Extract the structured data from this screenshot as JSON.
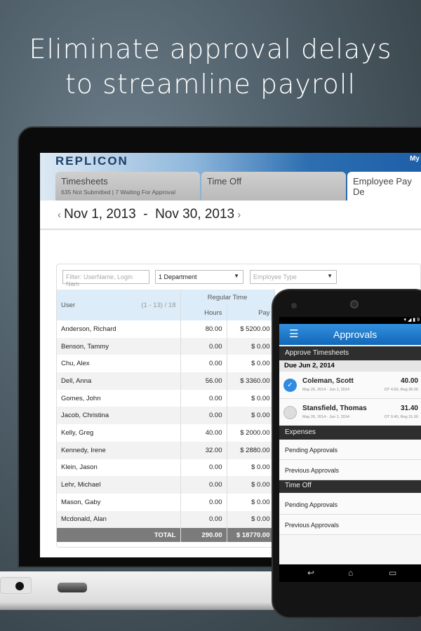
{
  "headline": [
    "Eliminate approval delays",
    "to streamline payroll"
  ],
  "web": {
    "logo": "REPLICON",
    "my": "My",
    "tabs": [
      {
        "label": "Timesheets",
        "sub1": "635 Not Submitted",
        "sub2": "7 Waiting For Approval"
      },
      {
        "label": "Time Off"
      },
      {
        "label": "Employee Pay De"
      }
    ],
    "date_range": "Nov 1, 2013  -  Nov 30, 2013",
    "filter_placeholder": "Filter: UserName, Login Nam",
    "department": "1 Department",
    "employee_type": "Employee Type",
    "headers": {
      "user": "User",
      "range": "(1 - 13) / 18",
      "regular": "Regular Time",
      "hours": "Hours",
      "pay": "Pay"
    },
    "rows": [
      [
        "Anderson, Richard",
        "80.00",
        "$ 5200.00"
      ],
      [
        "Benson, Tammy",
        "0.00",
        "$ 0.00"
      ],
      [
        "Chu, Alex",
        "0.00",
        "$ 0.00"
      ],
      [
        "Dell, Anna",
        "56.00",
        "$ 3360.00"
      ],
      [
        "Gomes, John",
        "0.00",
        "$ 0.00"
      ],
      [
        "Jacob, Christina",
        "0.00",
        "$ 0.00"
      ],
      [
        "Kelly, Greg",
        "40.00",
        "$ 2000.00"
      ],
      [
        "Kennedy, Irene",
        "32.00",
        "$ 2880.00"
      ],
      [
        "Klein, Jason",
        "0.00",
        "$ 0.00"
      ],
      [
        "Lehr, Michael",
        "0.00",
        "$ 0.00"
      ],
      [
        "Mason, Gaby",
        "0.00",
        "$ 0.00"
      ],
      [
        "Mcdonald, Alan",
        "0.00",
        "$ 0.00"
      ]
    ],
    "total": {
      "label": "TOTAL",
      "hours": "290.00",
      "pay": "$ 18770.00"
    }
  },
  "mobile": {
    "status": "9",
    "title": "Approvals",
    "approve_timesheets": "Approve Timesheets",
    "due": "Due Jun 2, 2014",
    "items": [
      {
        "name": "Coleman, Scott",
        "dates": "May 26, 2014 - Jun 1, 2014",
        "total": "40.00",
        "detail": "OT 4.00, Reg 36.00",
        "checked": true
      },
      {
        "name": "Stansfield, Thomas",
        "dates": "May 26, 2014 - Jun 1, 2014",
        "total": "31.40",
        "detail": "OT 0.40, Reg 31.00",
        "checked": false
      }
    ],
    "expenses": "Expenses",
    "time_off": "Time Off",
    "pending": "Pending Approvals",
    "previous": "Previous Approvals"
  }
}
